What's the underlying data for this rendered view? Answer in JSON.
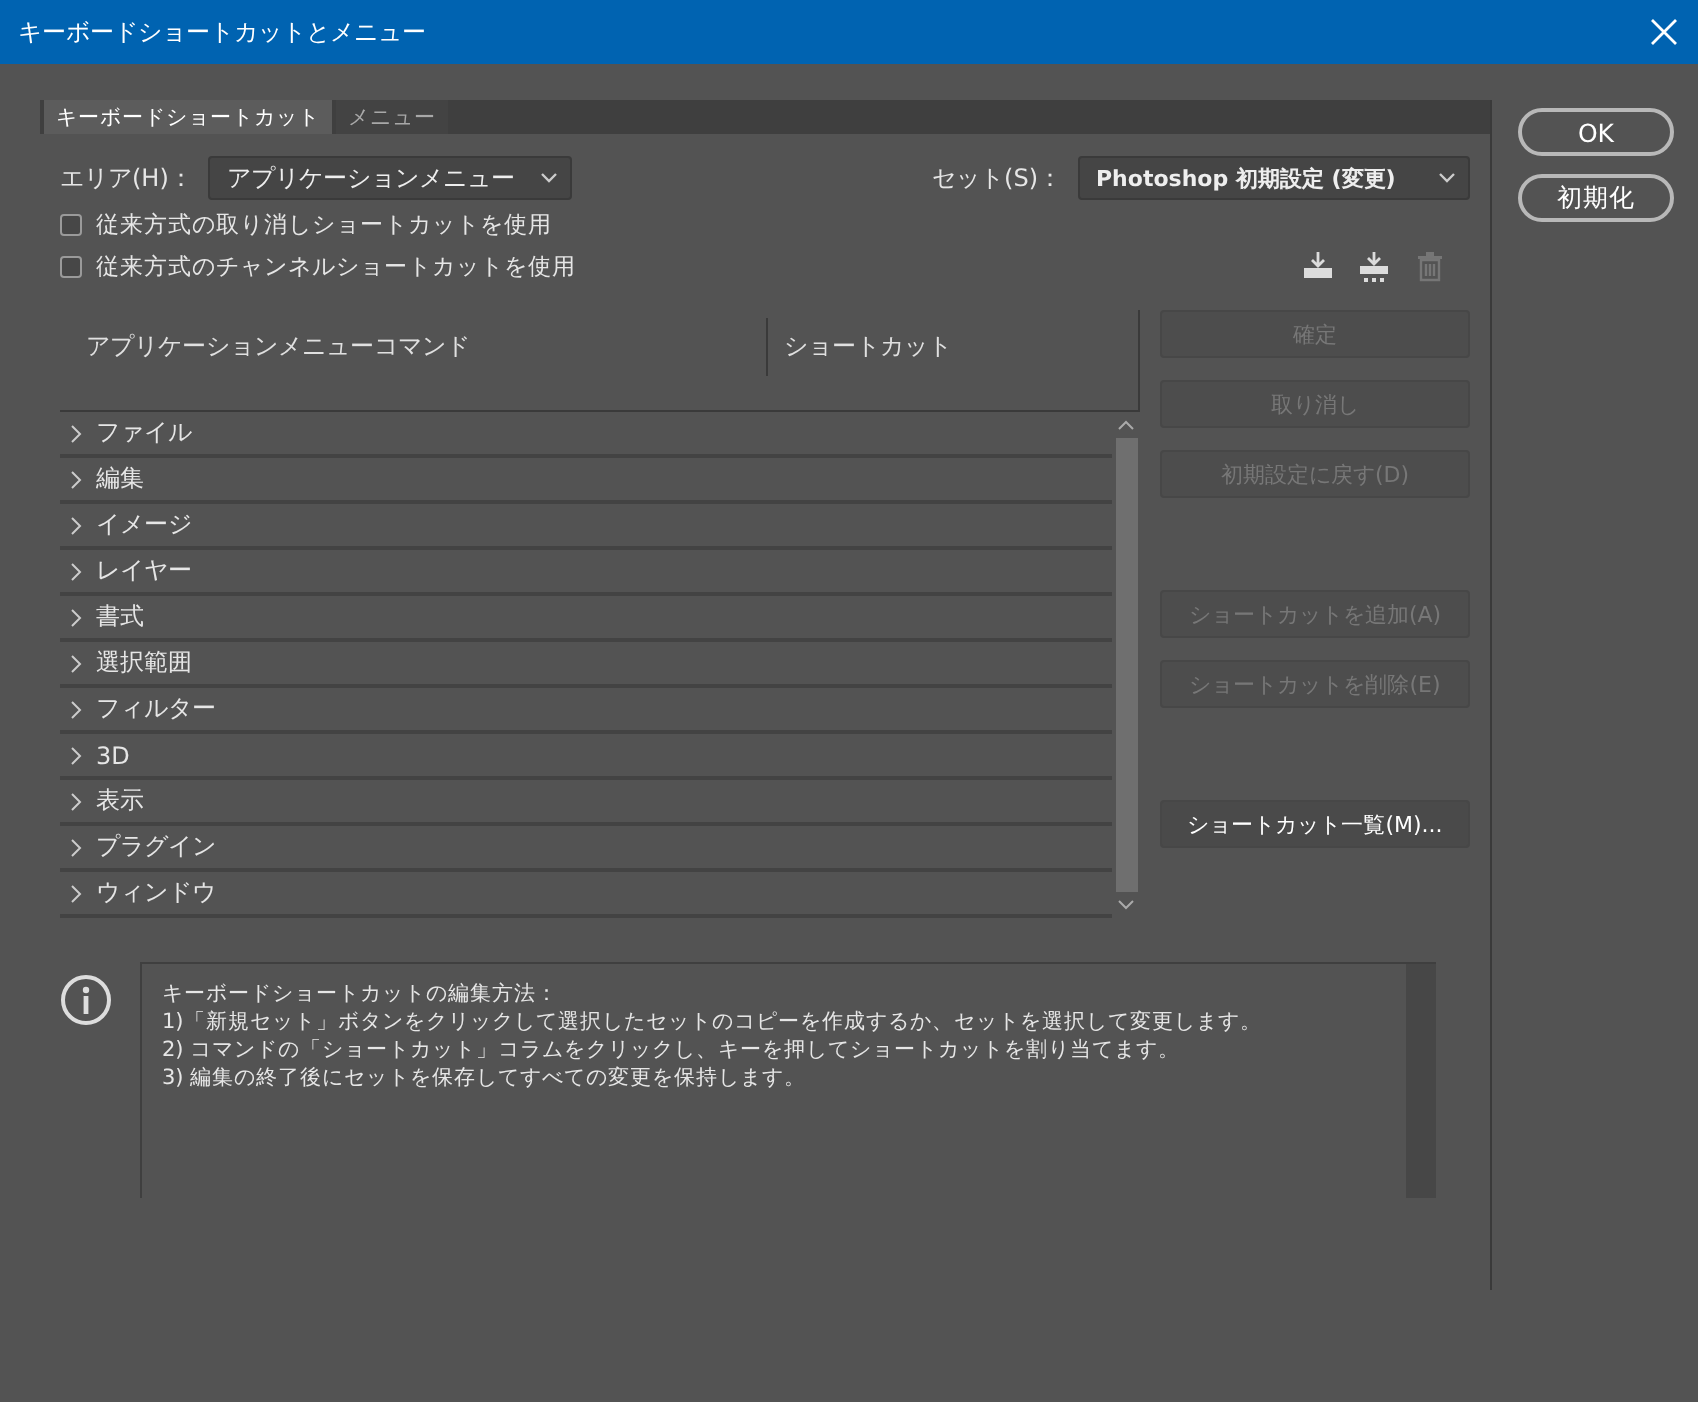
{
  "window": {
    "title": "キーボードショートカットとメニュー"
  },
  "tabs": [
    {
      "label": "キーボードショートカット",
      "selected": true
    },
    {
      "label": "メニュー",
      "selected": false
    }
  ],
  "area": {
    "label": "エリア(H)：",
    "value": "アプリケーションメニュー"
  },
  "set": {
    "label": "セット(S)：",
    "value": "Photoshop 初期設定 (変更)"
  },
  "options": [
    {
      "label": "従来方式の取り消しショートカットを使用",
      "checked": false
    },
    {
      "label": "従来方式のチャンネルショートカットを使用",
      "checked": false
    }
  ],
  "set_actions": [
    {
      "kind": "save",
      "disabled": false
    },
    {
      "kind": "new",
      "disabled": false
    },
    {
      "kind": "delete",
      "disabled": true
    }
  ],
  "table": {
    "columns": [
      "アプリケーションメニューコマンド",
      "ショートカット"
    ],
    "rows": [
      {
        "label": "ファイル",
        "expanded": false
      },
      {
        "label": "編集",
        "expanded": false
      },
      {
        "label": "イメージ",
        "expanded": false
      },
      {
        "label": "レイヤー",
        "expanded": false
      },
      {
        "label": "書式",
        "expanded": false
      },
      {
        "label": "選択範囲",
        "expanded": false
      },
      {
        "label": "フィルター",
        "expanded": false
      },
      {
        "label": "3D",
        "expanded": false
      },
      {
        "label": "表示",
        "expanded": false
      },
      {
        "label": "プラグイン",
        "expanded": false
      },
      {
        "label": "ウィンドウ",
        "expanded": false
      }
    ]
  },
  "action_buttons": [
    {
      "label": "確定",
      "disabled": true
    },
    {
      "label": "取り消し",
      "disabled": true
    },
    {
      "label": "初期設定に戻す(D)",
      "disabled": true
    },
    {
      "label": "ショートカットを追加(A)",
      "disabled": true
    },
    {
      "label": "ショートカットを削除(E)",
      "disabled": true
    },
    {
      "label": "ショートカット一覧(M)...",
      "disabled": false
    }
  ],
  "dialog_buttons": [
    {
      "label": "OK"
    },
    {
      "label": "初期化"
    }
  ],
  "help": {
    "lines": [
      "キーボードショートカットの編集方法：",
      "1)「新規セット」ボタンをクリックして選択したセットのコピーを作成するか、セットを選択して変更します。",
      "2) コマンドの「ショートカット」コラムをクリックし、キーを押してショートカットを割り当てます。",
      "3) 編集の終了後にセットを保存してすべての変更を保持します。"
    ]
  }
}
